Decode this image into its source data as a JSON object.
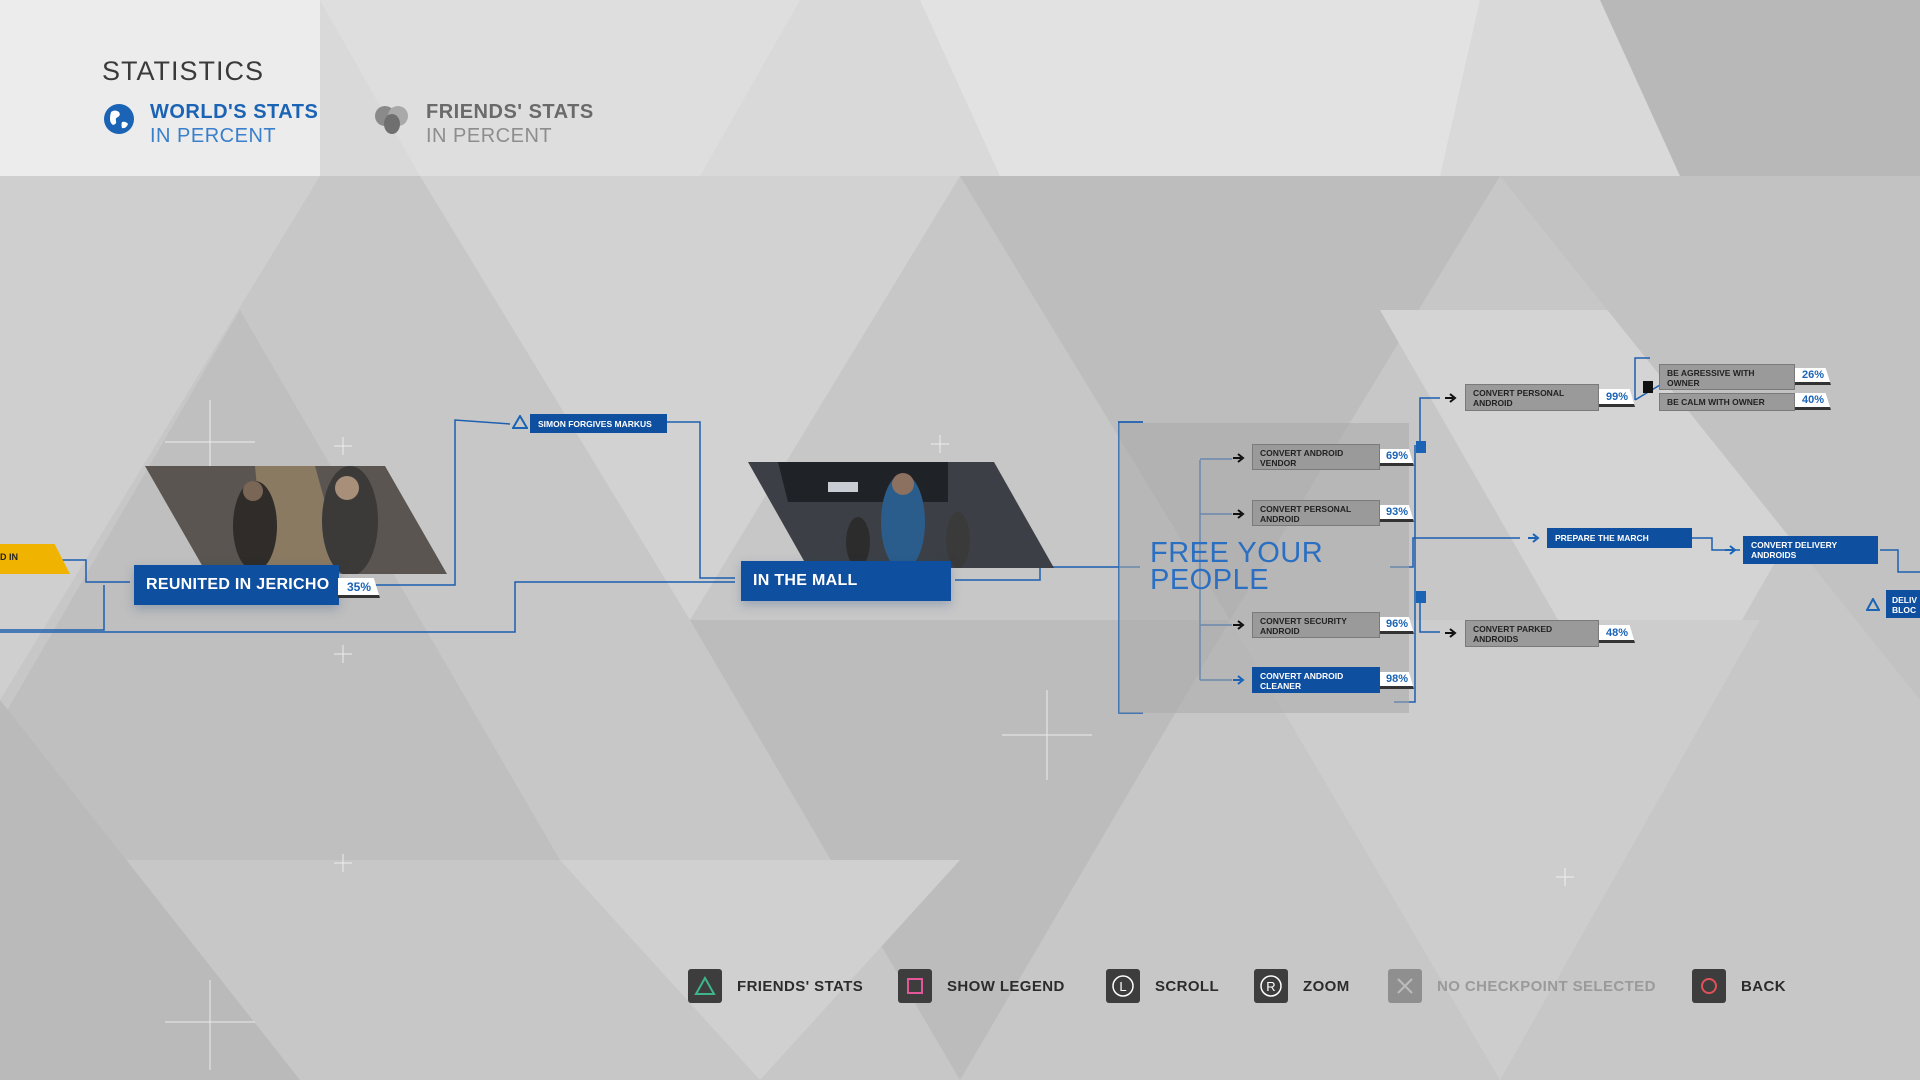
{
  "header": {
    "title": "STATISTICS",
    "tabs": [
      {
        "line1": "WORLD'S STATS",
        "line2": "IN PERCENT",
        "icon": "globe-icon",
        "active": true
      },
      {
        "line1": "FRIENDS' STATS",
        "line2": "IN PERCENT",
        "icon": "friends-icon",
        "active": false
      }
    ]
  },
  "flowchart": {
    "edge_left_label": "D IN",
    "reunited": {
      "label": "REUNITED IN JERICHO",
      "percent": "35%"
    },
    "simon": {
      "label": "SIMON FORGIVES MARKUS"
    },
    "mall": {
      "label": "IN THE MALL"
    },
    "free": {
      "line1": "FREE YOUR",
      "line2": "PEOPLE"
    },
    "convert_vendor": {
      "label1": "CONVERT ANDROID",
      "label2": "VENDOR",
      "percent": "69%"
    },
    "convert_personal": {
      "label1": "CONVERT PERSONAL",
      "label2": "ANDROID",
      "percent": "93%"
    },
    "convert_security": {
      "label1": "CONVERT SECURITY",
      "label2": "ANDROID",
      "percent": "96%"
    },
    "convert_cleaner": {
      "label1": "CONVERT ANDROID",
      "label2": "CLEANER",
      "percent": "98%"
    },
    "convert_personal_2": {
      "label1": "CONVERT PERSONAL",
      "label2": "ANDROID",
      "percent": "99%"
    },
    "aggressive": {
      "label1": "BE AGRESSIVE WITH",
      "label2": "OWNER",
      "percent": "26%"
    },
    "calm": {
      "label1": "BE CALM WITH OWNER",
      "percent": "40%"
    },
    "prepare": {
      "label": "PREPARE THE MARCH"
    },
    "parked": {
      "label1": "CONVERT PARKED",
      "label2": "ANDROIDS",
      "percent": "48%"
    },
    "delivery": {
      "label1": "CONVERT DELIVERY",
      "label2": "ANDROIDS"
    },
    "edge_right_label1": "DELIV",
    "edge_right_label2": "BLOC"
  },
  "hints": [
    {
      "label": "FRIENDS' STATS",
      "icon": "triangle-button-icon",
      "color": "#3fb58a"
    },
    {
      "label": "SHOW LEGEND",
      "icon": "square-button-icon",
      "color": "#e2569a"
    },
    {
      "label": "SCROLL",
      "icon": "left-stick-icon",
      "glyph": "L"
    },
    {
      "label": "ZOOM",
      "icon": "right-stick-icon",
      "glyph": "R"
    },
    {
      "label": "NO CHECKPOINT SELECTED",
      "icon": "cross-button-icon",
      "disabled": true
    },
    {
      "label": "BACK",
      "icon": "circle-button-icon",
      "color": "#e3505a"
    }
  ],
  "colors": {
    "accent": "#1a63b5",
    "node": "#0f4fa0",
    "highlight": "#f0b400"
  }
}
